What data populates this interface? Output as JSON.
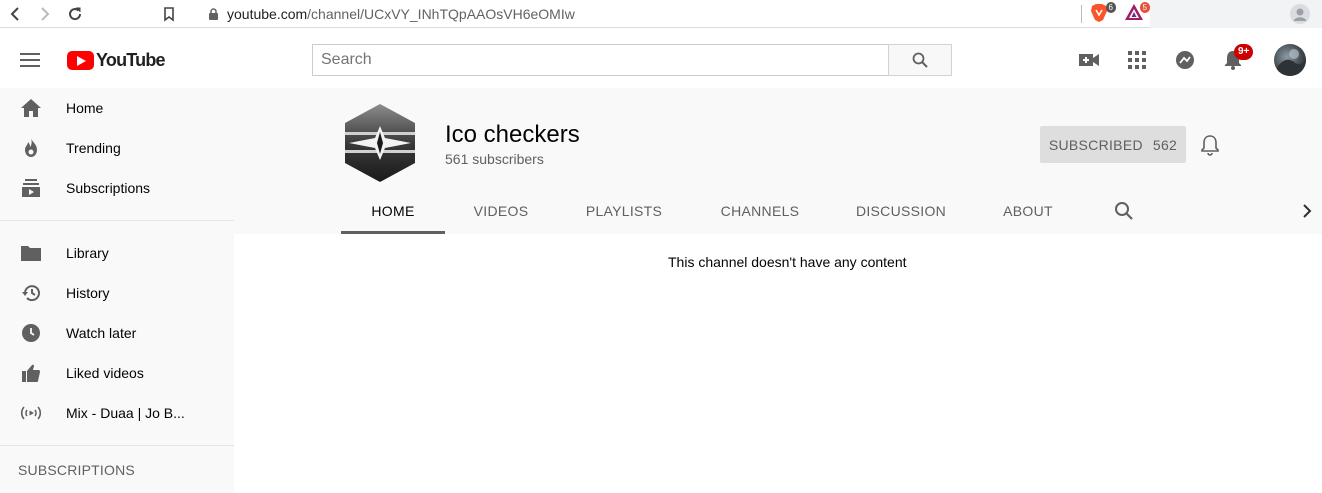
{
  "browser": {
    "url_host": "youtube.com",
    "url_path": "/channel/UCxVY_INhTQpAAOsVH6eOMIw",
    "ext_brave_count": "6",
    "ext_bat_count": "5"
  },
  "header": {
    "logo_text": "YouTube",
    "search_placeholder": "Search",
    "notifications_badge": "9+"
  },
  "sidebar": {
    "main_items": [
      {
        "label": "Home",
        "icon": "home-icon"
      },
      {
        "label": "Trending",
        "icon": "fire-icon"
      },
      {
        "label": "Subscriptions",
        "icon": "subscriptions-icon"
      }
    ],
    "library_items": [
      {
        "label": "Library",
        "icon": "folder-icon"
      },
      {
        "label": "History",
        "icon": "history-icon"
      },
      {
        "label": "Watch later",
        "icon": "clock-icon"
      },
      {
        "label": "Liked videos",
        "icon": "thumbs-up-icon"
      },
      {
        "label": "Mix - Duaa | Jo B...",
        "icon": "mix-icon"
      }
    ],
    "subscriptions_title": "SUBSCRIPTIONS"
  },
  "channel": {
    "name": "Ico checkers",
    "subscribers": "561 subscribers",
    "subscribed_label": "SUBSCRIBED",
    "subscribed_count": "562",
    "tabs": [
      "HOME",
      "VIDEOS",
      "PLAYLISTS",
      "CHANNELS",
      "DISCUSSION",
      "ABOUT"
    ],
    "active_tab": "HOME"
  },
  "content": {
    "empty_message": "This channel doesn't have any content"
  },
  "colors": {
    "brand_red": "#ff0000",
    "badge_red": "#cc0000",
    "sidebar_bg": "#f9f9f9"
  }
}
